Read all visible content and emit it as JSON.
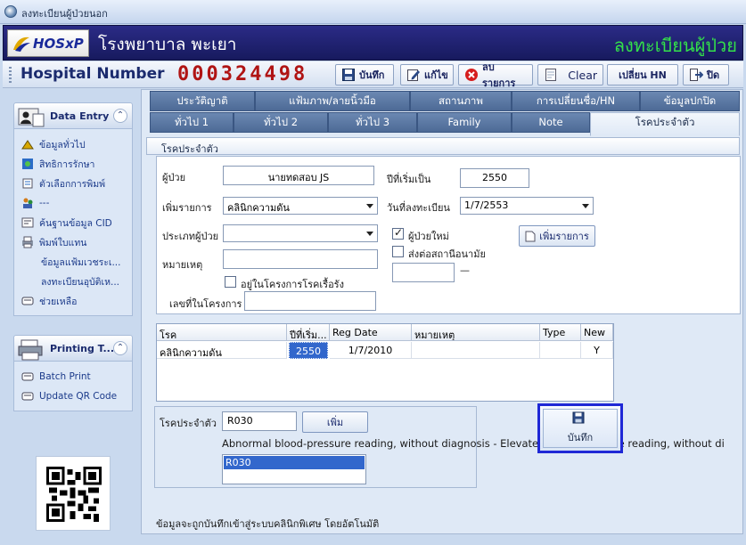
{
  "window": {
    "title": "ลงทะเบียนผู้ป่วยนอก"
  },
  "banner": {
    "logo_text": "HOSxP",
    "hospital_name": "โรงพยาบาล พะเยา",
    "module_title": "ลงทะเบียนผู้ป่วย"
  },
  "toolbar": {
    "hn_label": "Hospital Number",
    "hn_value": "000324498",
    "save_label": "บันทึก",
    "edit_label": "แก้ไข",
    "delete_label": "ลบรายการ",
    "clear_label": "Clear",
    "change_hn_label": "เปลี่ยน HN",
    "close_label": "ปิด"
  },
  "sidebar": {
    "data_entry": {
      "title": "Data Entry",
      "items": [
        {
          "label": "ข้อมูลทั่วไป"
        },
        {
          "label": "สิทธิการรักษา"
        },
        {
          "label": "ตัวเลือกการพิมพ์"
        },
        {
          "label": "---"
        },
        {
          "label": "ค้นฐานข้อมูล CID"
        },
        {
          "label": "พิมพ์ใบแทน"
        },
        {
          "label": "ข้อมูลแฟ้มเวชระเ..."
        },
        {
          "label": "ลงทะเบียนอุบัติเห..."
        },
        {
          "label": "ช่วยเหลือ"
        }
      ]
    },
    "printing": {
      "title": "Printing T...",
      "items": [
        {
          "label": "Batch Print"
        },
        {
          "label": "Update QR Code"
        }
      ]
    }
  },
  "tabs": {
    "row1": [
      "ประวัติญาติ",
      "แฟ้มภาพ/ลายนิ้วมือ",
      "สถานภาพ",
      "การเปลี่ยนชื่อ/HN",
      "ข้อมูลปกปิด"
    ],
    "row2": [
      "ทั่วไป 1",
      "ทั่วไป 2",
      "ทั่วไป 3",
      "Family",
      "Note",
      "โรคประจำตัว"
    ]
  },
  "subtab": {
    "label": "โรคประจำตัว"
  },
  "form": {
    "patient_label": "ผู้ป่วย",
    "patient_value": "นายทดสอบ JS",
    "start_year_label": "ปีที่เริ่มเป็น",
    "start_year_value": "2550",
    "add_item_label": "เพิ่มรายการ",
    "add_item_value": "คลินิกความดัน",
    "reg_date_label": "วันที่ลงทะเบียน",
    "reg_date_value": "1/7/2553",
    "patient_type_label": "ประเภทผู้ป่วย",
    "patient_type_value": "",
    "new_patient_label": "ผู้ป่วยใหม่",
    "new_patient_checked": true,
    "add_button_label": "เพิ่มรายการ",
    "note_label": "หมายเหตุ",
    "note_value": "",
    "refer_label": "ส่งต่อสถานีอนามัย",
    "refer_checked": false,
    "refer_value": "",
    "refer_dash": "—",
    "chronic_program_label": "อยู่ในโครงการโรคเรื้อรัง",
    "chronic_program_checked": false,
    "program_no_label": "เลขที่ในโครงการ",
    "program_no_value": ""
  },
  "grid": {
    "columns": [
      "โรค",
      "ปีที่เริ่ม...",
      "Reg Date",
      "หมายเหตุ",
      "Type",
      "New"
    ],
    "rows": [
      {
        "disease": "คลินิกความดัน",
        "start_year": "2550",
        "reg_date": "1/7/2010",
        "note": "",
        "type": "",
        "new": "Y"
      }
    ]
  },
  "cid": {
    "label": "โรคประจำตัว",
    "value": "R030",
    "add_label": "เพิ่ม",
    "description": "Abnormal blood-pressure reading, without diagnosis - Elevated blood-pressure reading, without di",
    "list": [
      "R030"
    ]
  },
  "save_big": {
    "label": "บันทึก"
  },
  "footnote": "ข้อมูลจะถูกบันทึกเข้าสู่ระบบคลินิกพิเศษ โดยอัตโนมัติ",
  "colors": {
    "banner": "#1f2272",
    "hn_value": "#b01414",
    "module_title": "#33e04a",
    "highlight": "#1f28d6",
    "selection": "#3267cc"
  }
}
